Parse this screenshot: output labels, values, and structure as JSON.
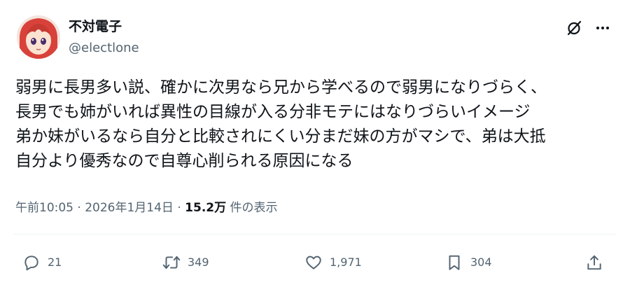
{
  "author": {
    "display_name": "不対電子",
    "handle": "@electlone",
    "avatar_icon": "anime-girl-avatar"
  },
  "header_actions": {
    "grok_icon": "grok-icon",
    "more_icon": "more-dots-icon"
  },
  "post": {
    "lines": [
      "弱男に長男多い説、確かに次男なら兄から学べるので弱男になりづらく、",
      "長男でも姉がいれば異性の目線が入る分非モテにはなりづらいイメージ",
      "弟か妹がいるなら自分と比較されにくい分まだ妹の方がマシで、弟は大抵",
      "自分より優秀なので自尊心削られる原因になる"
    ]
  },
  "meta": {
    "time": "午前10:05",
    "separator": " · ",
    "date": "2026年1月14日",
    "views_count": "15.2万",
    "views_label": "件の表示"
  },
  "actions": {
    "replies": "21",
    "retweets": "349",
    "likes": "1,971",
    "bookmarks": "304"
  },
  "colors": {
    "text_primary": "#0f1419",
    "text_secondary": "#536471",
    "divider": "#eff3f4",
    "avatar_hair": "#d9423a"
  }
}
